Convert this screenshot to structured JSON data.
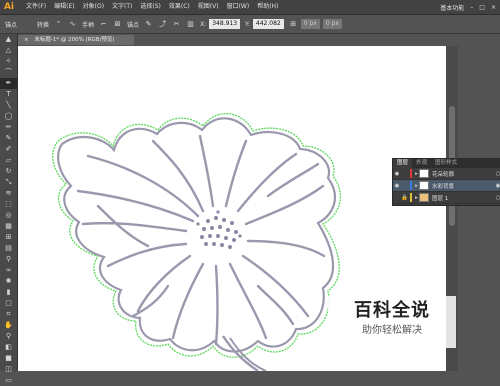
{
  "app": {
    "logo": "Ai",
    "workspace": "基本功能"
  },
  "menu": [
    "文件(F)",
    "编辑(E)",
    "对象(O)",
    "文字(T)",
    "选择(S)",
    "效果(C)",
    "视图(V)",
    "窗口(W)",
    "帮助(H)"
  ],
  "control_bar": {
    "anchor_label": "锚点",
    "convert_label": "转换",
    "handle_label": "手柄",
    "anchor_label2": "锚点",
    "x_label": "X:",
    "x_value": "348.913",
    "y_label": "Y:",
    "y_value": "442.082",
    "w_value": "0 px",
    "h_value": "0 px"
  },
  "document_tab": {
    "title": "未标题-1* @ 200% (RGB/预览)",
    "close": "×"
  },
  "layers_panel": {
    "tabs": [
      "图层",
      "外观",
      "图形样式"
    ],
    "layers": [
      {
        "name": "花朵轮廓",
        "color": "#e03a3a",
        "selected": false
      },
      {
        "name": "水彩背景",
        "color": "#3a7de0",
        "selected": true
      },
      {
        "name": "图层 1",
        "color": "#e0c23a",
        "selected": false
      }
    ]
  },
  "watermark": {
    "title": "百科全说",
    "subtitle": "助你轻松解决"
  },
  "colors": {
    "outline": "#8a8aa0",
    "selection": "#5bd85b",
    "panel_bg": "#3d3d3d"
  }
}
